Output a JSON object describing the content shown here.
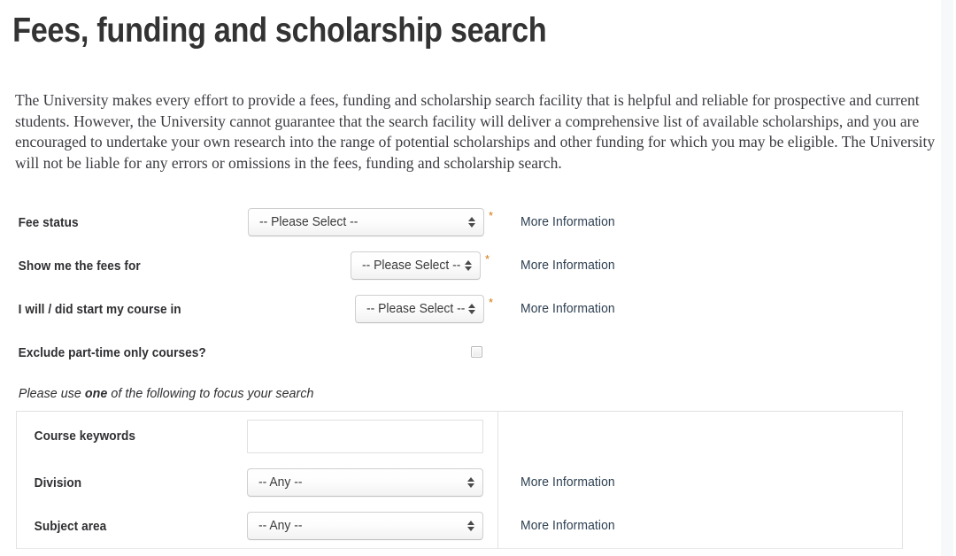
{
  "page": {
    "title": "Fees, funding and scholarship search",
    "intro": "The University makes every effort to provide a fees, funding and scholarship search facility that is helpful and reliable for prospective and current students. However, the University cannot guarantee that the search facility will deliver a comprehensive list of available scholarships, and you are encouraged to undertake your own research into the range of potential scholarships and other funding for which you may be eligible. The University will not be liable for any errors or omissions in the fees, funding and scholarship search.",
    "required_marker": "*",
    "more_information_label": "More Information",
    "accent_link_color": "#2e4052",
    "required_marker_color": "#d4750e",
    "border_color": "#e2e2e2"
  },
  "top_form": {
    "rows": [
      {
        "label": "Fee status",
        "control": "select",
        "value": "-- Please Select --",
        "required": true,
        "has_more_info": true
      },
      {
        "label": "Show me the fees for",
        "control": "select",
        "value": "-- Please Select --",
        "required": true,
        "has_more_info": true
      },
      {
        "label": "I will / did start my course in",
        "control": "select",
        "value": "-- Please Select --",
        "required": true,
        "has_more_info": true
      },
      {
        "label": "Exclude part-time only courses?",
        "control": "checkbox",
        "checked": false,
        "required": false,
        "has_more_info": false
      }
    ]
  },
  "focus_hint": {
    "before": "Please use ",
    "emphasis": "one",
    "after": " of the following to focus your search"
  },
  "panel": {
    "rows": [
      {
        "label": "Course keywords",
        "control": "text",
        "value": "",
        "placeholder": "",
        "has_more_info": false
      },
      {
        "label": "Division",
        "control": "select",
        "value": "-- Any --",
        "has_more_info": true
      },
      {
        "label": "Subject area",
        "control": "select",
        "value": "-- Any --",
        "has_more_info": true
      }
    ]
  }
}
